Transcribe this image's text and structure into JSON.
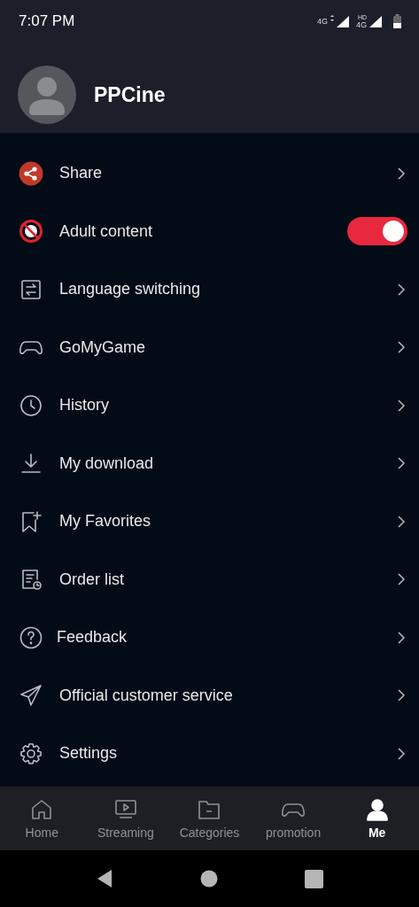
{
  "status_bar": {
    "time": "7:07 PM",
    "network_1": "4G",
    "network_2": "4G",
    "hd": "HD"
  },
  "profile": {
    "name": "PPCine"
  },
  "menu": [
    {
      "label": "Share",
      "kind": "link"
    },
    {
      "label": "Adult content",
      "kind": "toggle",
      "on": true
    },
    {
      "label": "Language switching",
      "kind": "link"
    },
    {
      "label": "GoMyGame",
      "kind": "link"
    },
    {
      "label": "History",
      "kind": "link"
    },
    {
      "label": "My download",
      "kind": "link"
    },
    {
      "label": "My Favorites",
      "kind": "link"
    },
    {
      "label": "Order list",
      "kind": "link"
    },
    {
      "label": "Feedback",
      "kind": "link"
    },
    {
      "label": "Official customer service",
      "kind": "link"
    },
    {
      "label": "Settings",
      "kind": "link"
    }
  ],
  "tabs": [
    {
      "label": "Home",
      "selected": false
    },
    {
      "label": "Streaming",
      "selected": false
    },
    {
      "label": "Categories",
      "selected": false
    },
    {
      "label": "promotion",
      "selected": false
    },
    {
      "label": "Me",
      "selected": true
    }
  ]
}
